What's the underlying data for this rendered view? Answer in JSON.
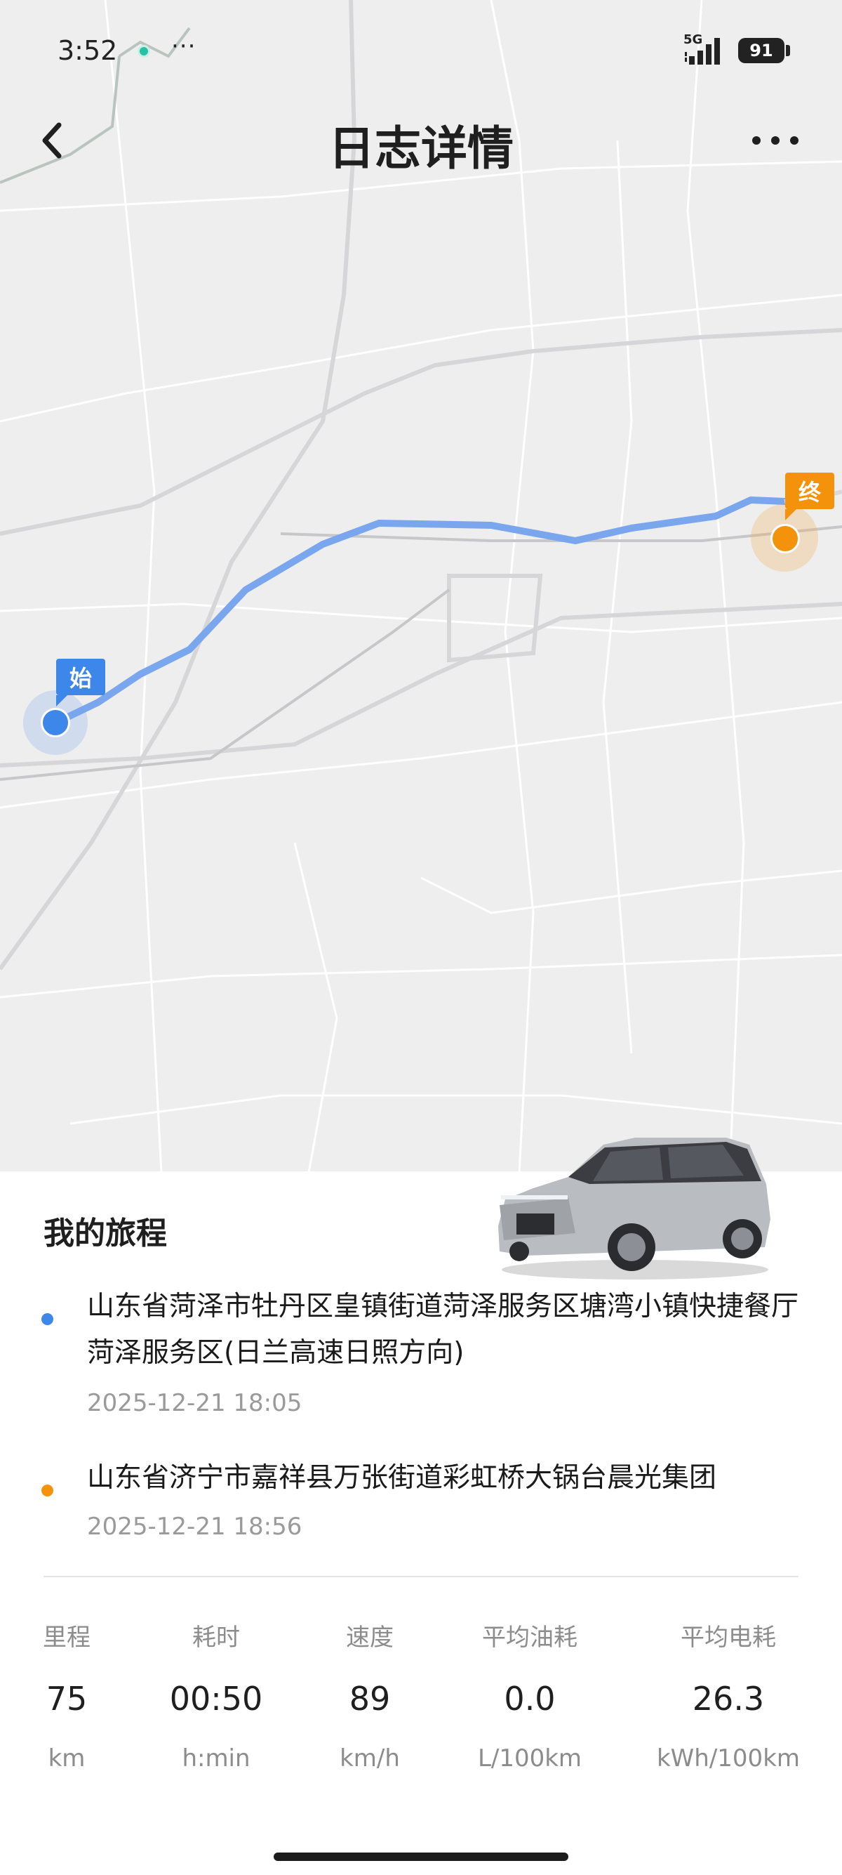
{
  "status_bar": {
    "time": "3:52",
    "more": "···",
    "network": "5G",
    "battery": "91"
  },
  "header": {
    "title": "日志详情",
    "back_icon": "chevron-left-icon",
    "more_icon": "more-horizontal-icon"
  },
  "map": {
    "start_tag": "始",
    "end_tag": "终",
    "route_color": "#7aa6ee",
    "start_color": "#3d86ea",
    "end_color": "#f5920b"
  },
  "trip": {
    "section_title": "我的旅程",
    "start": {
      "address": "山东省菏泽市牡丹区皇镇街道菏泽服务区塘湾小镇快捷餐厅菏泽服务区(日兰高速日照方向)",
      "time": "2025-12-21 18:05"
    },
    "end": {
      "address": "山东省济宁市嘉祥县万张街道彩虹桥大锅台晨光集团",
      "time": "2025-12-21 18:56"
    }
  },
  "stats": [
    {
      "label": "里程",
      "value": "75",
      "unit": "km"
    },
    {
      "label": "耗时",
      "value": "00:50",
      "unit": "h:min"
    },
    {
      "label": "速度",
      "value": "89",
      "unit": "km/h"
    },
    {
      "label": "平均油耗",
      "value": "0.0",
      "unit": "L/100km"
    },
    {
      "label": "平均电耗",
      "value": "26.3",
      "unit": "kWh/100km"
    }
  ]
}
